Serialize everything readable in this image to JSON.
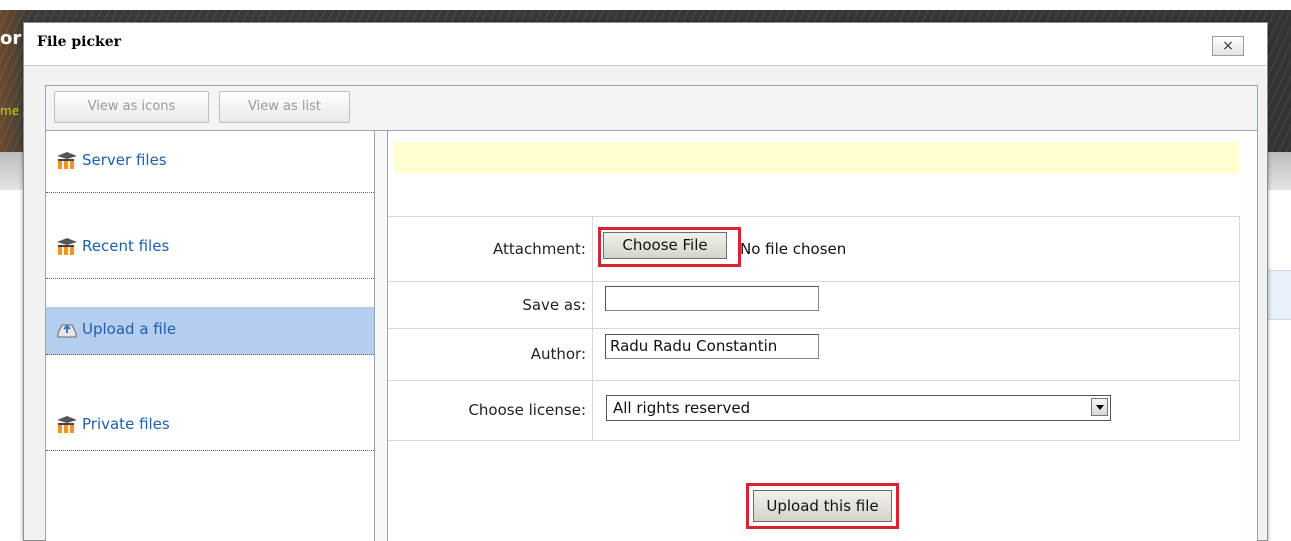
{
  "background_page": {
    "title_fragment": "or",
    "link_fragment": "me"
  },
  "dialog": {
    "title": "File picker",
    "close_glyph": "×"
  },
  "toolbar": {
    "view_icons_label": "View as icons",
    "view_list_label": "View as list"
  },
  "sidebar": {
    "items": [
      {
        "label": "Server files",
        "icon": "moodle-icon",
        "active": false
      },
      {
        "label": "Recent files",
        "icon": "moodle-icon",
        "active": false
      },
      {
        "label": "Upload a file",
        "icon": "upload-icon",
        "active": true
      },
      {
        "label": "Private files",
        "icon": "moodle-icon",
        "active": false
      }
    ]
  },
  "upload_form": {
    "attachment_label": "Attachment:",
    "choose_file_label": "Choose File",
    "no_file_text": "No file chosen",
    "save_as_label": "Save as:",
    "save_as_value": "",
    "author_label": "Author:",
    "author_value": "Radu Radu Constantin",
    "license_label": "Choose license:",
    "license_selected": "All rights reserved",
    "upload_button_label": "Upload this file"
  },
  "colors": {
    "highlight": "#d9232e",
    "active_nav": "#b5cdee",
    "link": "#1f5fae",
    "message_bar": "#fffecf"
  }
}
